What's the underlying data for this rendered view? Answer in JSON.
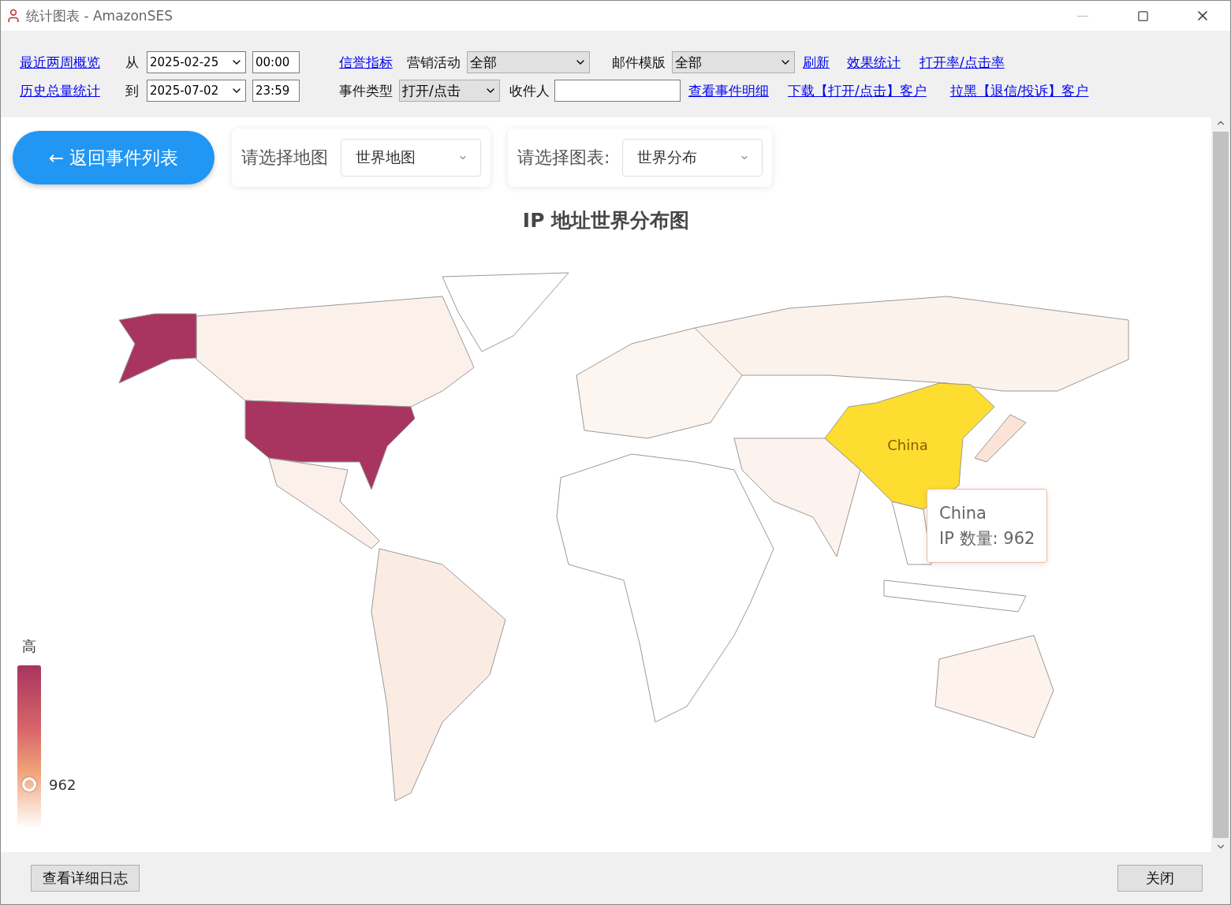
{
  "window": {
    "title": "统计图表 - AmazonSES"
  },
  "toolbar": {
    "top_line": [
      {
        "kind": "link",
        "text": "最近两周概览"
      },
      {
        "kind": "label",
        "text": "从"
      },
      {
        "kind": "date",
        "value": "2025-02-25"
      },
      {
        "kind": "time",
        "value": "00:00"
      },
      {
        "kind": "link",
        "text": "信誉指标"
      },
      {
        "kind": "label",
        "text": "营销活动"
      },
      {
        "kind": "select",
        "value": "全部"
      },
      {
        "kind": "label",
        "text": "邮件模版"
      },
      {
        "kind": "select",
        "value": "全部"
      },
      {
        "kind": "link",
        "text": "刷新"
      },
      {
        "kind": "link",
        "text": "效果统计"
      },
      {
        "kind": "link",
        "text": "打开率/点击率"
      }
    ],
    "bottom_line": [
      {
        "kind": "link",
        "text": "历史总量统计"
      },
      {
        "kind": "label",
        "text": "到"
      },
      {
        "kind": "date",
        "value": "2025-07-02"
      },
      {
        "kind": "time",
        "value": "23:59"
      },
      {
        "kind": "label",
        "text": "事件类型"
      },
      {
        "kind": "select",
        "value": "打开/点击"
      },
      {
        "kind": "label",
        "text": "收件人"
      },
      {
        "kind": "input"
      },
      {
        "kind": "link",
        "text": "查看事件明细"
      },
      {
        "kind": "link",
        "text": "下载【打开/点击】客户"
      },
      {
        "kind": "link",
        "text": "拉黑【退信/投诉】客户"
      }
    ]
  },
  "back_button": {
    "label": "← 返回事件列表"
  },
  "map_picker": {
    "label": "请选择地图",
    "value": "世界地图"
  },
  "chart_picker": {
    "label": "请选择图表:",
    "value": "世界分布"
  },
  "chart": {
    "title": "IP 地址世界分布图",
    "highlight_label": "China",
    "tooltip": {
      "name": "China",
      "line": "IP 数量: 962"
    },
    "legend": {
      "high_label": "高",
      "value": "962",
      "level": 0.27
    }
  },
  "footer": {
    "buttons": [
      {
        "label": "查看详细日志"
      },
      {
        "label": "关闭"
      }
    ]
  }
}
